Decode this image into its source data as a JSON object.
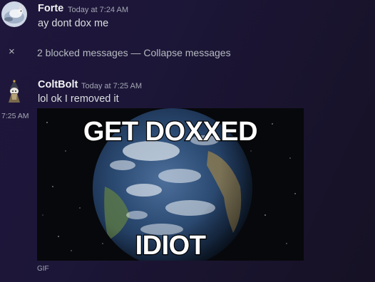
{
  "messages": [
    {
      "username": "Forte",
      "timestamp": "Today at 7:24 AM",
      "text": "ay dont dox me"
    },
    {
      "username": "ColtBolt",
      "timestamp": "Today at 7:25 AM",
      "text": "lol ok I removed it",
      "side_timestamp": "7:25 AM",
      "gif": {
        "caption_top": "GET DOXXED",
        "caption_bottom": "IDIOT",
        "label": "GIF"
      }
    }
  ],
  "blocked": {
    "close_icon": "×",
    "text": "2 blocked messages — ",
    "collapse_label": "Collapse messages"
  },
  "colors": {
    "username": "#f2f3f5",
    "timestamp": "#a3a6b3",
    "message_text": "#dbdee1",
    "background_start": "#20173c",
    "background_end": "#161124"
  },
  "icons": {
    "close": "close-icon"
  }
}
